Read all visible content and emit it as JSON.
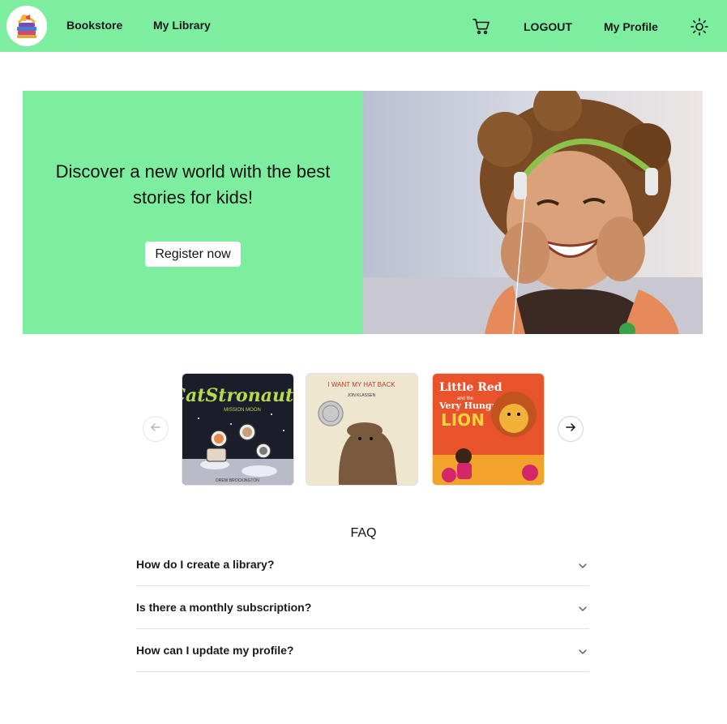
{
  "navbar": {
    "logo_icon": "bookstore-logo-icon",
    "bookstore_label": "Bookstore",
    "library_label": "My Library",
    "cart_icon": "cart-icon",
    "logout_label": "LOGOUT",
    "profile_label": "My Profile",
    "theme_icon": "sun-icon",
    "background": "#7ded9f"
  },
  "hero": {
    "title": "Discover a new world with the best stories for kids!",
    "button_label": "Register now",
    "background": "#7ded9f"
  },
  "carousel": {
    "prev_icon": "arrow-left-icon",
    "next_icon": "arrow-right-icon",
    "books": [
      {
        "title": "CatStronauts",
        "subtitle": "MISSION MOON",
        "author": "DREW BROCKINGTON"
      },
      {
        "title": "I WANT MY HAT BACK",
        "author": "JON KLASSEN"
      },
      {
        "title_line1": "Little Red",
        "title_line2": "and the",
        "title_line3": "Very Hungry",
        "title_line4": "LION"
      }
    ]
  },
  "faq": {
    "title": "FAQ",
    "items": [
      {
        "question": "How do I create a library?"
      },
      {
        "question": "Is there a monthly subscription?"
      },
      {
        "question": "How can I update my profile?"
      }
    ]
  }
}
